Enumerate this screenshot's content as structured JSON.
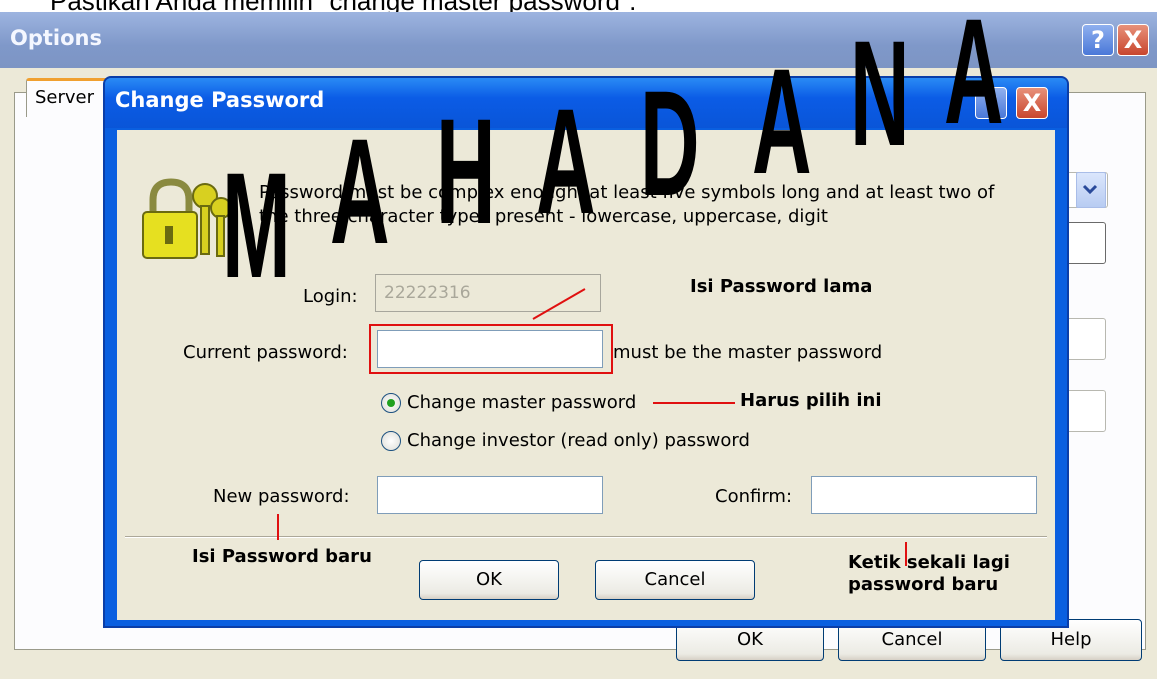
{
  "top_caption": "Pastikan Anda memilih \"change master password\".",
  "options_window": {
    "title": "Options",
    "help_button": "?",
    "close_button": "X",
    "tab_server": "Server",
    "ok_label": "OK",
    "cancel_label": "Cancel",
    "help_label": "Help"
  },
  "dialog": {
    "title": "Change Password",
    "help_button": "?",
    "close_button": "X",
    "info_line1": "Password must be complex enough, at least five symbols long and at least two of",
    "info_line2": "the three character types present - lowercase, uppercase, digit",
    "login_label": "Login:",
    "login_value": "22222316",
    "current_password_label": "Current password:",
    "current_password_value": "",
    "current_password_hint": "must be the master password",
    "radio_master_label": "Change master password",
    "radio_investor_label": "Change investor (read only) password",
    "selected_radio": "master",
    "new_password_label": "New password:",
    "new_password_value": "",
    "confirm_label": "Confirm:",
    "confirm_value": "",
    "ok_label": "OK",
    "cancel_label": "Cancel"
  },
  "annotations": {
    "old_password": "Isi Password lama",
    "must_choose": "Harus pilih ini",
    "new_password": "Isi Password baru",
    "retype_line1": "Ketik sekali lagi",
    "retype_line2": "password baru"
  },
  "watermark": [
    "M",
    "A",
    "H",
    "A",
    "D",
    "A",
    "N",
    "A"
  ],
  "colors": {
    "dialog_blue": "#0a5fe0",
    "annotation_red": "#e01010",
    "radio_selected": "#21a121"
  }
}
